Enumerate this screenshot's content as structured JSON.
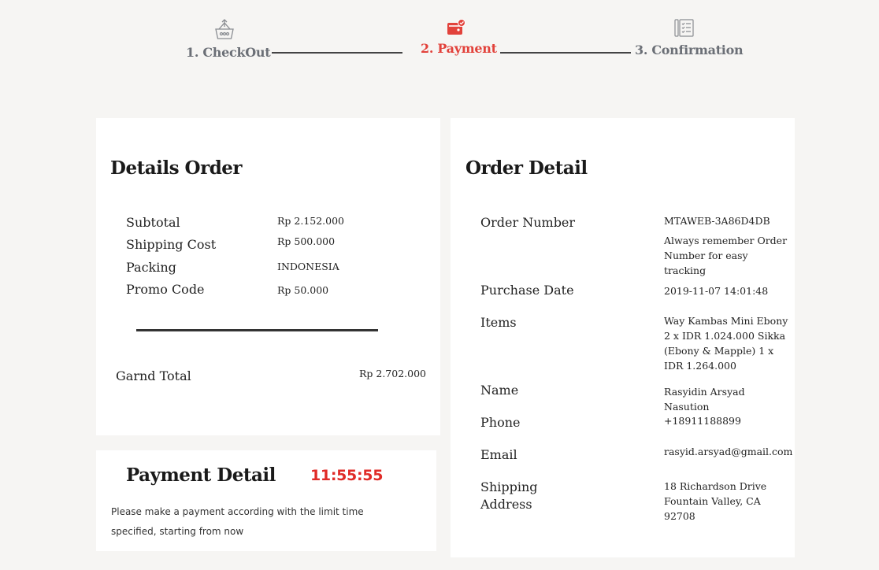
{
  "stepper": {
    "steps": [
      {
        "label": "1. CheckOut",
        "icon": "basket-icon",
        "active": false
      },
      {
        "label": "2. Payment",
        "icon": "wallet-icon",
        "active": true
      },
      {
        "label": "3. Confirmation",
        "icon": "checklist-icon",
        "active": false
      }
    ]
  },
  "details_order": {
    "title": "Details Order",
    "rows": [
      {
        "label": "Subtotal",
        "value": "Rp 2.152.000"
      },
      {
        "label": "Shipping Cost",
        "value": "Rp 500.000"
      },
      {
        "label": "Packing",
        "value": "INDONESIA"
      },
      {
        "label": "Promo Code",
        "value": "Rp 50.000"
      }
    ],
    "grand_total_label": "Garnd Total",
    "grand_total_value": "Rp 2.702.000"
  },
  "payment_detail": {
    "title": "Payment Detail",
    "timer": "11:55:55",
    "note": "Please make a payment according with the limit time specified, starting from now"
  },
  "order_detail": {
    "title": "Order Detail",
    "order_number_label": "Order Number",
    "order_number": "MTAWEB-3A86D4DB",
    "order_number_note": "Always remember Order Number for easy tracking",
    "purchase_date_label": "Purchase Date",
    "purchase_date": "2019-11-07 14:01:48",
    "items_label": "Items",
    "items": "Way Kambas Mini Ebony 2 x IDR 1.024.000 Sikka (Ebony & Mapple) 1 x IDR 1.264.000",
    "name_label": "Name",
    "name": "Rasyidin Arsyad Nasution",
    "phone_label": "Phone",
    "phone": "+18911188899",
    "email_label": "Email",
    "email": "rasyid.arsyad@gmail.com",
    "shipping_label": "Shipping Address",
    "shipping_address": "18 Richardson Drive Fountain Valley, CA 92708"
  },
  "colors": {
    "accent": "#e2423b",
    "timer": "#e02b27",
    "inactive_step": "#6b6f76",
    "background": "#f6f5f3"
  }
}
